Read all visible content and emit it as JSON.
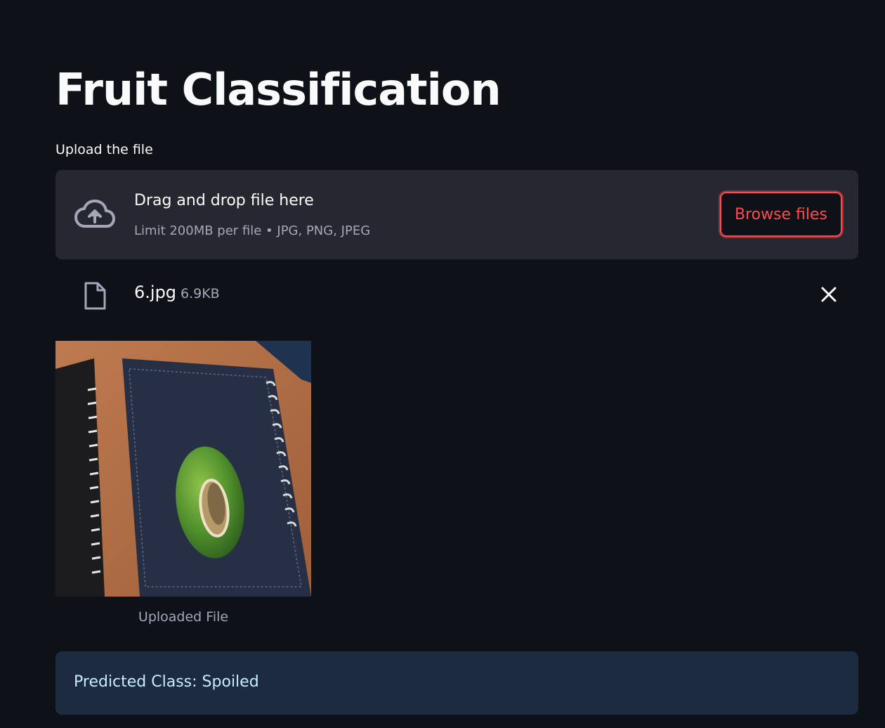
{
  "page": {
    "title": "Fruit Classification"
  },
  "uploader": {
    "label": "Upload the file",
    "drop_text": "Drag and drop file here",
    "limit_text": "Limit 200MB per file • JPG, PNG, JPEG",
    "browse_label": "Browse files",
    "icon": "cloud-upload-icon"
  },
  "file": {
    "name": "6.jpg",
    "size": "6.9KB",
    "icon": "file-icon",
    "remove_icon": "close-icon"
  },
  "image": {
    "caption": "Uploaded File"
  },
  "result": {
    "text": "Predicted Class: Spoiled"
  },
  "colors": {
    "background": "#0e1117",
    "dropzone": "#262730",
    "accent": "#ff4b4b",
    "info_box": "#1c2b40",
    "info_text": "#c7ebff"
  }
}
